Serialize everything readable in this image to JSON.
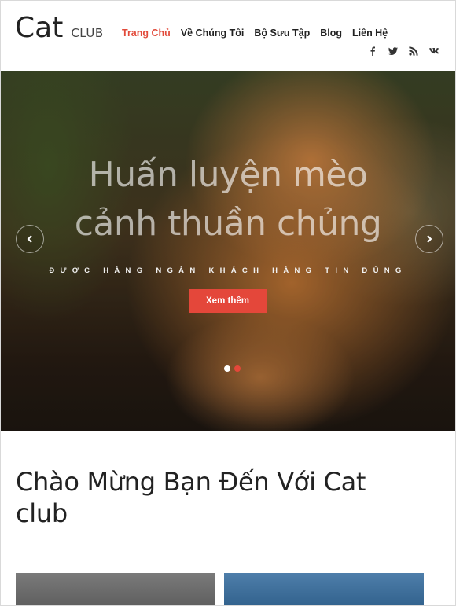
{
  "logo": {
    "main": "Cat",
    "sub": "CLUB"
  },
  "nav": {
    "items": [
      {
        "label": "Trang Chủ",
        "active": true
      },
      {
        "label": "Về Chúng Tôi",
        "active": false
      },
      {
        "label": "Bộ Sưu Tập",
        "active": false
      },
      {
        "label": "Blog",
        "active": false
      },
      {
        "label": "Liên Hệ",
        "active": false
      }
    ],
    "active_color": "#e24b3b"
  },
  "social": [
    "facebook-icon",
    "twitter-icon",
    "rss-icon",
    "vk-icon"
  ],
  "hero": {
    "title_line1": "Huấn luyện mèo",
    "title_line2": "cảnh thuần chủng",
    "subtitle": "ĐƯỢC HÀNG NGÀN KHÁCH HÀNG TIN DÙNG",
    "button_label": "Xem thêm",
    "button_color": "#e4473a",
    "slides": 2,
    "active_slide": 2
  },
  "welcome": {
    "heading": "Chào Mừng Bạn Đến Với Cat club"
  }
}
